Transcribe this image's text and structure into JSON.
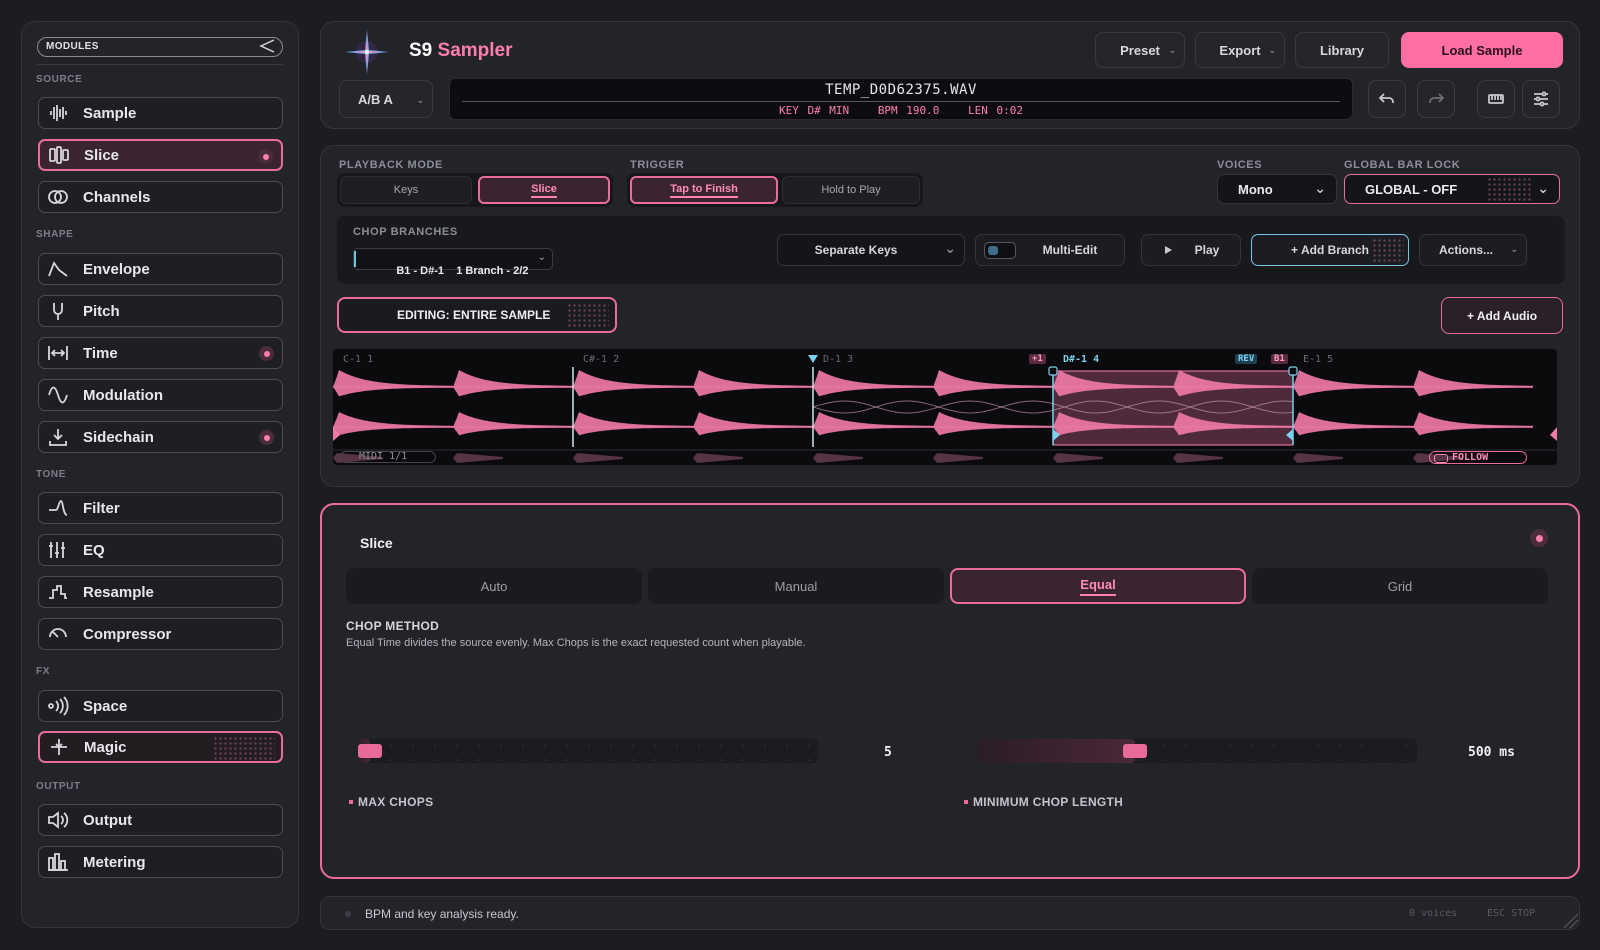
{
  "sidebar": {
    "header": "MODULES",
    "sections": {
      "source": "SOURCE",
      "shape": "SHAPE",
      "tone": "TONE",
      "fx": "FX",
      "output": "OUTPUT"
    },
    "items": {
      "sample": "Sample",
      "slice": "Slice",
      "channels": "Channels",
      "envelope": "Envelope",
      "pitch": "Pitch",
      "time": "Time",
      "modulation": "Modulation",
      "sidechain": "Sidechain",
      "filter": "Filter",
      "eq": "EQ",
      "resample": "Resample",
      "compressor": "Compressor",
      "space": "Space",
      "magic": "Magic",
      "output": "Output",
      "metering": "Metering"
    }
  },
  "header": {
    "title_a": "S9",
    "title_b": "Sampler",
    "preset": "Preset",
    "export": "Export",
    "library": "Library",
    "load_sample": "Load Sample",
    "ab": "A/B A",
    "file_name": "TEMP_D0D62375.WAV",
    "key": "KEY D# MIN",
    "bpm": "BPM 190.0",
    "len": "LEN 0:02"
  },
  "main": {
    "playback_mode_label": "PLAYBACK MODE",
    "playback_modes": [
      "Keys",
      "Slice"
    ],
    "trigger_label": "TRIGGER",
    "triggers": [
      "Tap to Finish",
      "Hold to Play"
    ],
    "voices_label": "VOICES",
    "voices_value": "Mono",
    "global_bar_lock_label": "GLOBAL BAR LOCK",
    "global_bar_lock_value": "GLOBAL - OFF",
    "chop_branches_label": "CHOP BRANCHES",
    "branch_value": "B1 - D#-1    1 Branch - 2/2",
    "key_mode": "Separate Keys",
    "multi_edit": "Multi-Edit",
    "play": "Play",
    "add_branch": "+ Add Branch",
    "actions": "Actions...",
    "editing": "EDITING: ENTIRE SAMPLE",
    "add_audio": "+ Add Audio"
  },
  "waveform": {
    "slices": [
      "C-1 1",
      "C#-1 2",
      "D-1 3",
      "D#-1 4",
      "E-1 5"
    ],
    "tag_plus": "+1",
    "tag_rev": "REV",
    "tag_b1": "B1",
    "midi": "MIDI 1/1",
    "follow": "FOLLOW",
    "colors": {
      "wave": "#f27aa8",
      "selection": "#ff7eb0",
      "marker": "#7cd1f0"
    }
  },
  "slice_panel": {
    "title": "Slice",
    "modes": [
      "Auto",
      "Manual",
      "Equal",
      "Grid"
    ],
    "active_mode": "Equal",
    "chop_method_label": "CHOP METHOD",
    "chop_method_desc": "Equal Time divides the source evenly. Max Chops is the exact requested count when playable.",
    "max_chops_label": "MAX CHOPS",
    "max_chops_value": "5",
    "max_chops_level": 0.0,
    "min_chop_label": "MINIMUM CHOP LENGTH",
    "min_chop_value": "500 ms",
    "min_chop_level": 0.35
  },
  "status": {
    "message": "BPM and key analysis ready.",
    "voices": "0 voices",
    "esc": "ESC STOP"
  },
  "colors": {
    "accent": "#ff6fa3",
    "background": "#1c1d22",
    "panel": "#232429"
  }
}
